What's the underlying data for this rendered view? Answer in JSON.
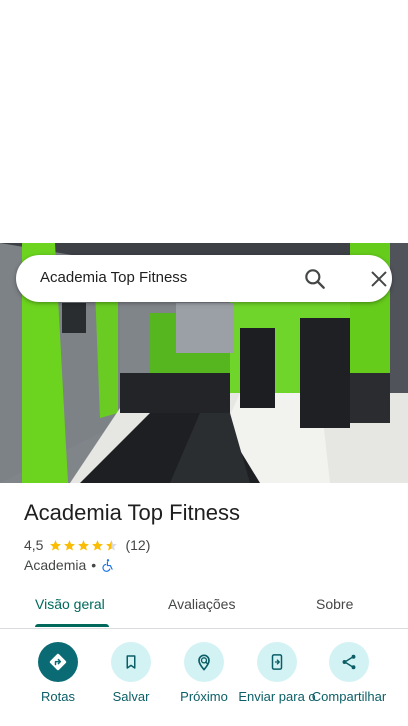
{
  "search": {
    "query": "Academia Top Fitness"
  },
  "place": {
    "name": "Academia Top Fitness",
    "rating": "4,5",
    "rating_value": 4.5,
    "review_count": "(12)",
    "category": "Academia",
    "separator": "•"
  },
  "tabs": [
    {
      "label": "Visão geral",
      "selected": true
    },
    {
      "label": "Avaliações",
      "selected": false
    },
    {
      "label": "Sobre",
      "selected": false
    }
  ],
  "actions": [
    {
      "label": "Rotas",
      "icon": "directions-icon"
    },
    {
      "label": "Salvar",
      "icon": "bookmark-icon"
    },
    {
      "label": "Próximo",
      "icon": "nearby-icon"
    },
    {
      "label": "Enviar para o",
      "icon": "send-to-phone-icon"
    },
    {
      "label": "Compartilhar",
      "icon": "share-icon"
    }
  ],
  "colors": {
    "accent": "#00695c",
    "action_primary": "#0b6b74",
    "action_secondary": "#d3f2f4",
    "star": "#fbbc04",
    "accessibility": "#1a73e8"
  }
}
